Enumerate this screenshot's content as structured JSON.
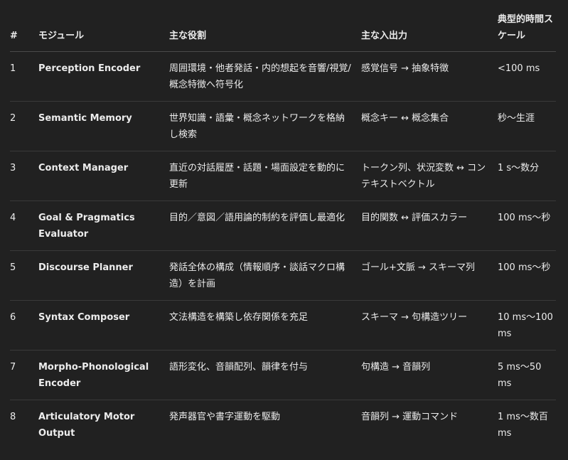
{
  "table": {
    "headers": {
      "num": "#",
      "module": "モジュール",
      "role": "主な役割",
      "io": "主な入出力",
      "timescale": "典型的時間スケール"
    },
    "rows": [
      {
        "num": "1",
        "module": "Perception Encoder",
        "role": "周囲環境・他者発話・内的想起を音響/視覚/概念特徴へ符号化",
        "io": "感覚信号 → 抽象特徴",
        "timescale": "<100 ms"
      },
      {
        "num": "2",
        "module": "Semantic Memory",
        "role": "世界知識・語彙・概念ネットワークを格納し検索",
        "io": "概念キー ↔ 概念集合",
        "timescale": "秒〜生涯"
      },
      {
        "num": "3",
        "module": "Context Manager",
        "role": "直近の対話履歴・話題・場面設定を動的に更新",
        "io": "トークン列、状況変数 ↔ コンテキストベクトル",
        "timescale": "1 s〜数分"
      },
      {
        "num": "4",
        "module": "Goal & Pragmatics Evaluator",
        "role": "目的／意図／語用論的制約を評価し最適化",
        "io": "目的関数 ↔ 評価スカラー",
        "timescale": "100 ms〜秒"
      },
      {
        "num": "5",
        "module": "Discourse Planner",
        "role": "発話全体の構成（情報順序・談話マクロ構造）を計画",
        "io": "ゴール+文脈 → スキーマ列",
        "timescale": "100 ms〜秒"
      },
      {
        "num": "6",
        "module": "Syntax Composer",
        "role": "文法構造を構築し依存関係を充足",
        "io": "スキーマ → 句構造ツリー",
        "timescale": "10 ms〜100 ms"
      },
      {
        "num": "7",
        "module": "Morpho-Phonological Encoder",
        "role": "語形変化、音韻配列、韻律を付与",
        "io": "句構造 → 音韻列",
        "timescale": "5 ms〜50 ms"
      },
      {
        "num": "8",
        "module": "Articulatory Motor Output",
        "role": "発声器官や書字運動を駆動",
        "io": "音韻列 → 運動コマンド",
        "timescale": "1 ms〜数百 ms"
      }
    ]
  }
}
